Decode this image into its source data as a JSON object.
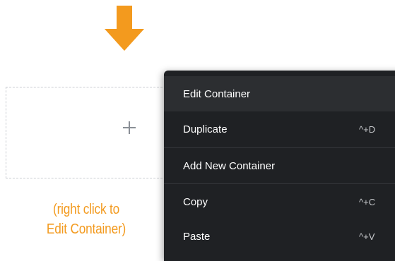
{
  "arrow": {
    "icon": "arrow-down-icon",
    "color": "#f39a1e"
  },
  "container": {
    "add_icon": "plus-icon"
  },
  "caption": {
    "line1": "(right click to",
    "line2": "Edit Container)",
    "color": "#f39a1e"
  },
  "menu": {
    "items": [
      {
        "label": "Edit Container",
        "shortcut": ""
      },
      {
        "label": "Duplicate",
        "shortcut": "^+D"
      },
      {
        "label": "Add New Container",
        "shortcut": ""
      },
      {
        "label": "Copy",
        "shortcut": "^+C"
      },
      {
        "label": "Paste",
        "shortcut": "^+V"
      }
    ]
  }
}
